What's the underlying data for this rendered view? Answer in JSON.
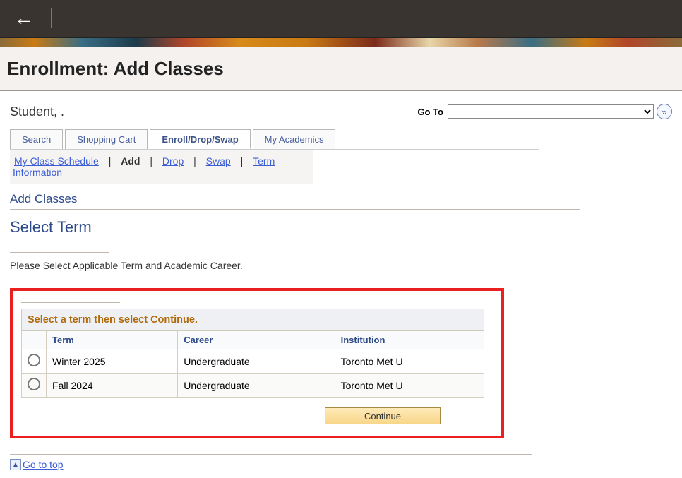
{
  "page_title": "Enrollment: Add Classes",
  "student_name": "Student, .",
  "goto": {
    "label": "Go To",
    "value": ""
  },
  "tabs": [
    {
      "label": "Search"
    },
    {
      "label": "Shopping Cart"
    },
    {
      "label": "Enroll/Drop/Swap"
    },
    {
      "label": "My Academics"
    }
  ],
  "sub_links": {
    "schedule": "My Class Schedule",
    "add": "Add",
    "drop": "Drop",
    "swap": "Swap",
    "term_info": "Term Information"
  },
  "headings": {
    "add_classes": "Add Classes",
    "select_term": "Select Term",
    "instruction": "Please Select Applicable Term and Academic Career."
  },
  "term_table": {
    "caption": "Select a term then select Continue.",
    "headers": {
      "term": "Term",
      "career": "Career",
      "institution": "Institution"
    },
    "rows": [
      {
        "term": "Winter 2025",
        "career": "Undergraduate",
        "institution": "Toronto Met U"
      },
      {
        "term": "Fall 2024",
        "career": "Undergraduate",
        "institution": "Toronto Met U"
      }
    ]
  },
  "buttons": {
    "continue": "Continue"
  },
  "footer": {
    "go_to_top": "Go to top"
  }
}
